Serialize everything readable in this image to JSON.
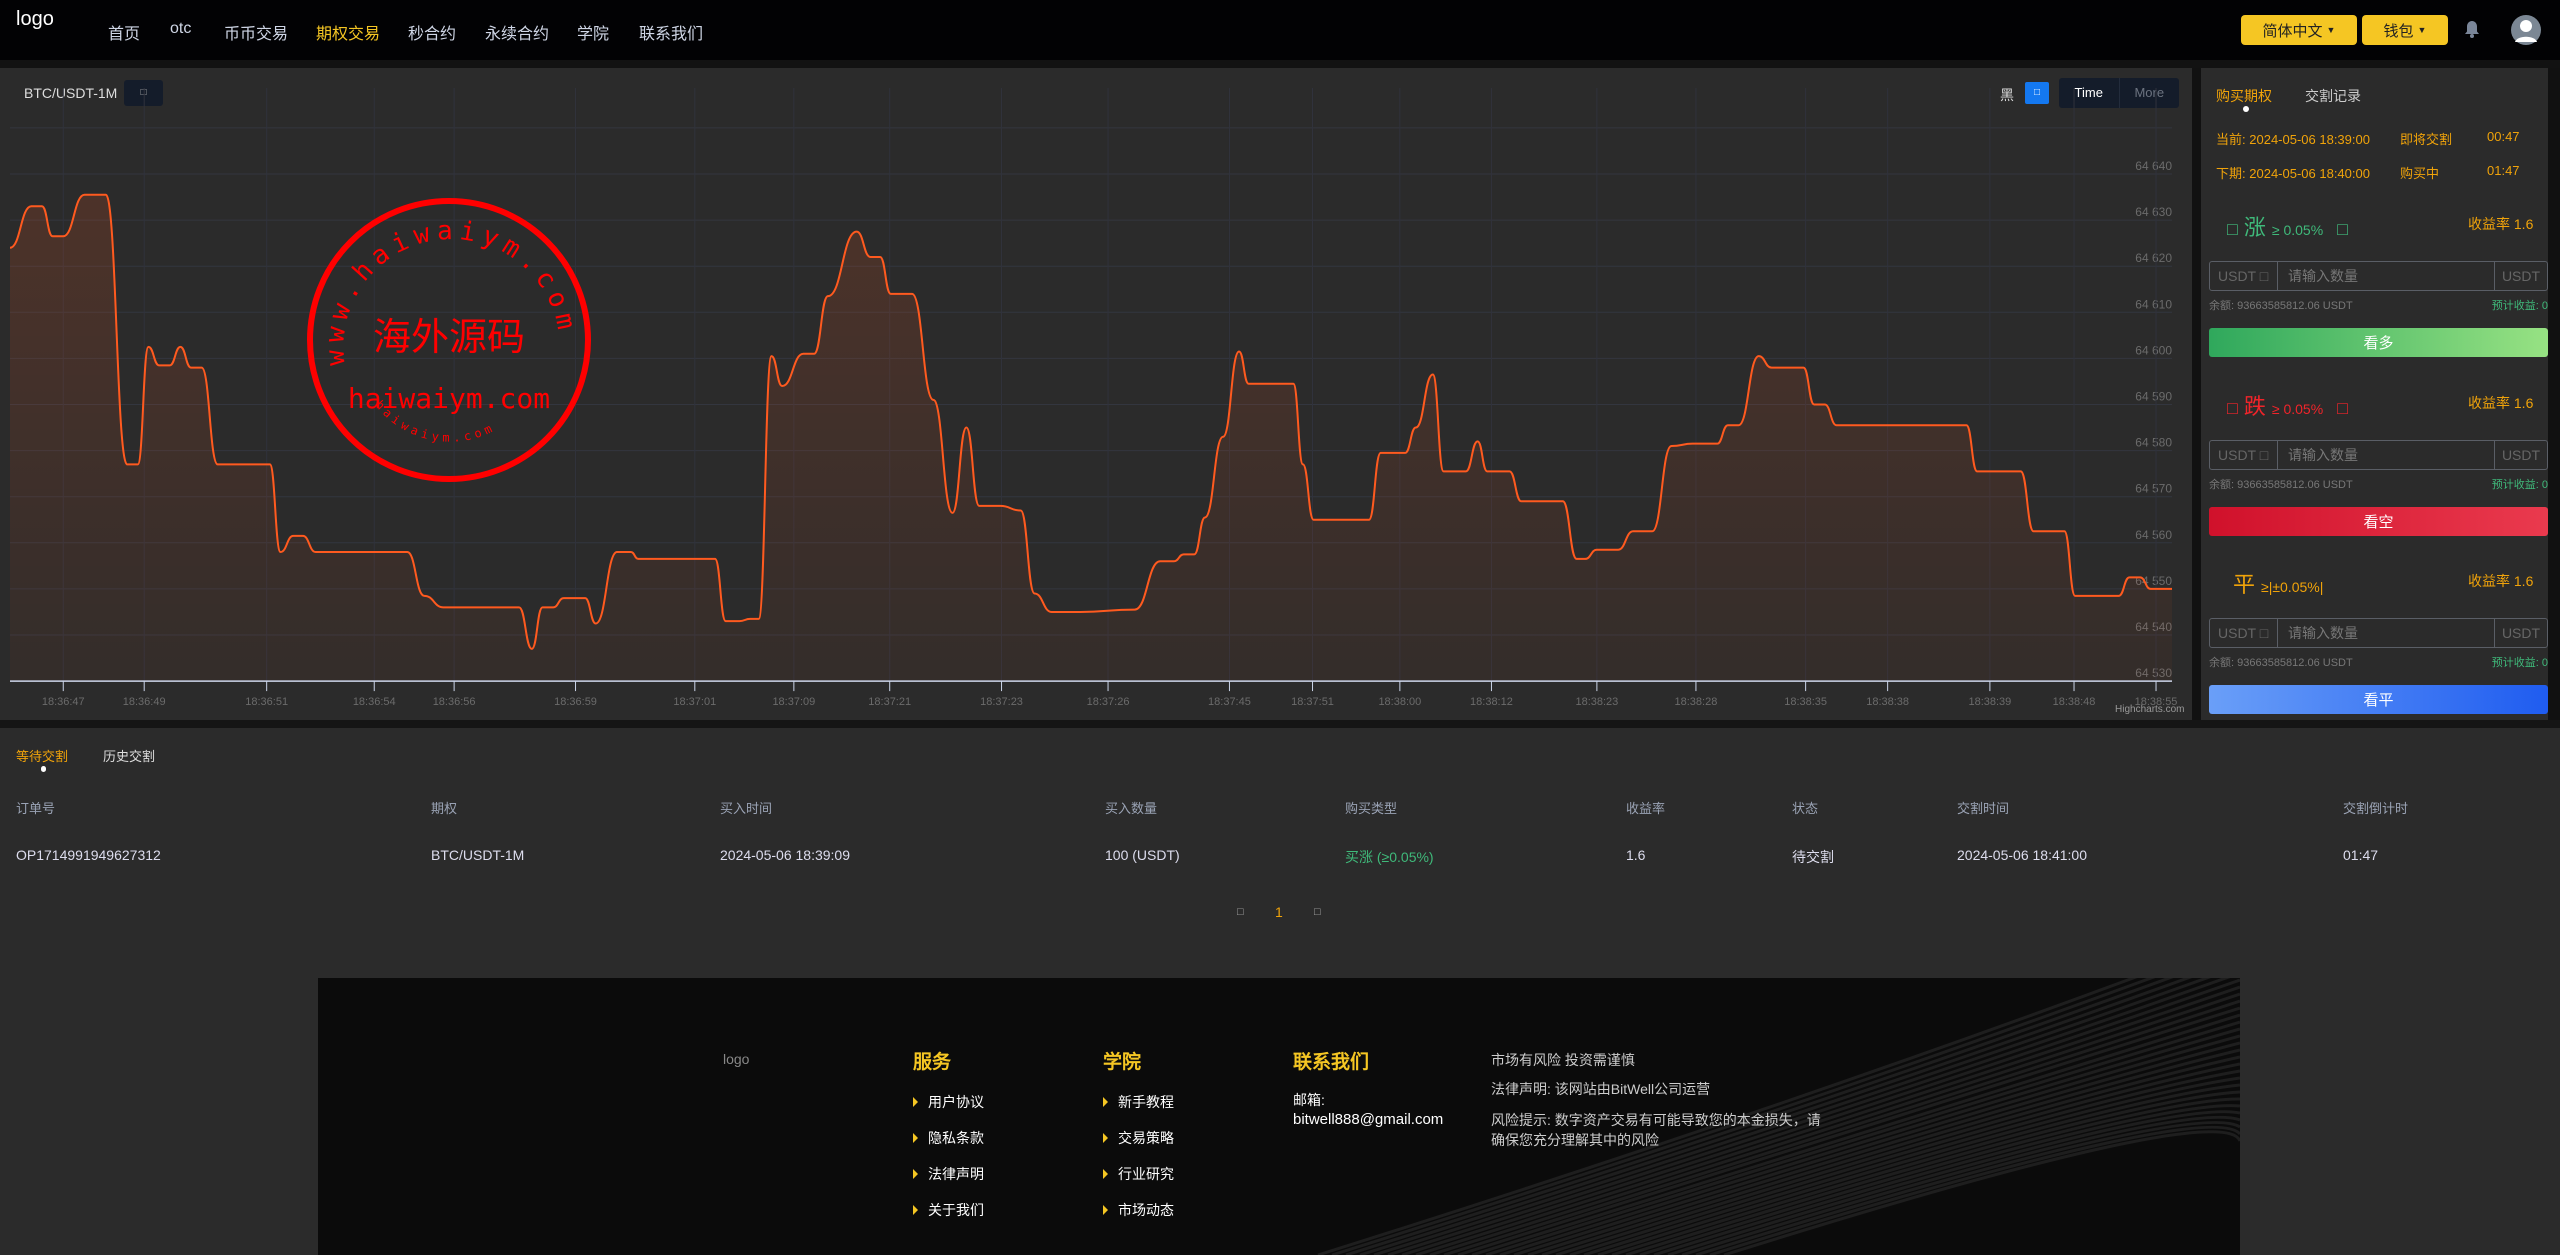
{
  "header": {
    "logo_alt": "logo",
    "nav": [
      "首页",
      "otc",
      "币币交易",
      "期权交易",
      "秒合约",
      "永续合约",
      "学院",
      "联系我们"
    ],
    "active_nav": 3,
    "language": "简体中文",
    "wallet": "钱包",
    "accent": "#f5c623"
  },
  "chart": {
    "pair": "BTC/USDT-1M",
    "theme_label": "黑",
    "range_time": "Time",
    "range_more": "More",
    "credit": "Highcharts.com",
    "watermark": {
      "top_text": "www.haiwaiym.com",
      "center_text": "海外源码",
      "bottom_text": "haiwaiym.com",
      "small_text": "haiwaiym.com"
    }
  },
  "chart_data": {
    "type": "area",
    "line_color": "#ff5a1f",
    "ylim": [
      64530,
      64640
    ],
    "y_ticks": [
      "64 640",
      "64 630",
      "64 620",
      "64 610",
      "64 600",
      "64 590",
      "64 580",
      "64 570",
      "64 560",
      "64 550",
      "64 540",
      "64 530"
    ],
    "y_tick_values": [
      64640,
      64630,
      64620,
      64610,
      64600,
      64590,
      64580,
      64570,
      64560,
      64550,
      64540,
      64530
    ],
    "x_range": [
      0,
      203
    ],
    "x_ticks": [
      {
        "i": 5,
        "label": "18:36:47"
      },
      {
        "i": 12.6,
        "label": "18:36:49"
      },
      {
        "i": 24.1,
        "label": "18:36:51"
      },
      {
        "i": 34.2,
        "label": "18:36:54"
      },
      {
        "i": 41.7,
        "label": "18:36:56"
      },
      {
        "i": 53.1,
        "label": "18:36:59"
      },
      {
        "i": 64.3,
        "label": "18:37:01"
      },
      {
        "i": 73.6,
        "label": "18:37:09"
      },
      {
        "i": 82.6,
        "label": "18:37:21"
      },
      {
        "i": 93.1,
        "label": "18:37:23"
      },
      {
        "i": 103.1,
        "label": "18:37:26"
      },
      {
        "i": 114.5,
        "label": "18:37:45"
      },
      {
        "i": 122.3,
        "label": "18:37:51"
      },
      {
        "i": 130.5,
        "label": "18:38:00"
      },
      {
        "i": 139.1,
        "label": "18:38:12"
      },
      {
        "i": 149,
        "label": "18:38:23"
      },
      {
        "i": 158.3,
        "label": "18:38:28"
      },
      {
        "i": 168.6,
        "label": "18:38:35"
      },
      {
        "i": 176.3,
        "label": "18:38:38"
      },
      {
        "i": 185.9,
        "label": "18:38:39"
      },
      {
        "i": 193.8,
        "label": "18:38:48"
      },
      {
        "i": 201.5,
        "label": "18:38:55"
      }
    ],
    "points": [
      [
        0,
        64624
      ],
      [
        2,
        64633
      ],
      [
        3,
        64633
      ],
      [
        4,
        64626.5
      ],
      [
        5,
        64626.5
      ],
      [
        7,
        64635.5
      ],
      [
        9,
        64635.5
      ],
      [
        11,
        64577
      ],
      [
        12,
        64577
      ],
      [
        13,
        64602.5
      ],
      [
        14,
        64598.5
      ],
      [
        15,
        64598.5
      ],
      [
        16,
        64602.5
      ],
      [
        17,
        64598
      ],
      [
        18,
        64598
      ],
      [
        19.5,
        64577
      ],
      [
        24.4,
        64577
      ],
      [
        25.4,
        64558
      ],
      [
        26.6,
        64561.5
      ],
      [
        27.5,
        64561.5
      ],
      [
        28.7,
        64558
      ],
      [
        37.3,
        64558
      ],
      [
        38.9,
        64548.5
      ],
      [
        40.7,
        64546
      ],
      [
        47.8,
        64546
      ],
      [
        49,
        64537
      ],
      [
        50,
        64546
      ],
      [
        51,
        64546
      ],
      [
        52,
        64548
      ],
      [
        54,
        64548
      ],
      [
        55,
        64542.5
      ],
      [
        57,
        64558
      ],
      [
        58.3,
        64558
      ],
      [
        59,
        64556.5
      ],
      [
        66.2,
        64556.5
      ],
      [
        67.2,
        64543
      ],
      [
        68.5,
        64543
      ],
      [
        69.5,
        64543.5
      ],
      [
        70.3,
        64543.5
      ],
      [
        71.5,
        64600.5
      ],
      [
        72.5,
        64594
      ],
      [
        74.5,
        64601
      ],
      [
        75.5,
        64601
      ],
      [
        76.8,
        64613.5
      ],
      [
        79.5,
        64627.5
      ],
      [
        80.8,
        64622
      ],
      [
        81.7,
        64622
      ],
      [
        82.7,
        64614
      ],
      [
        84.7,
        64614
      ],
      [
        86.7,
        64591
      ],
      [
        88.5,
        64566.5
      ],
      [
        89.8,
        64585
      ],
      [
        91,
        64568
      ],
      [
        93,
        64568
      ],
      [
        94.9,
        64567
      ],
      [
        96.2,
        64549
      ],
      [
        97.8,
        64545
      ],
      [
        100.5,
        64545
      ],
      [
        105.6,
        64545.5
      ],
      [
        108,
        64556
      ],
      [
        109.3,
        64556
      ],
      [
        110.2,
        64557.5
      ],
      [
        111.2,
        64557.5
      ],
      [
        112.2,
        64565.5
      ],
      [
        113.9,
        64583
      ],
      [
        115.4,
        64601.5
      ],
      [
        116.3,
        64594.5
      ],
      [
        120.5,
        64594.5
      ],
      [
        121.4,
        64577
      ],
      [
        122.4,
        64565
      ],
      [
        127.6,
        64565
      ],
      [
        128.7,
        64579.5
      ],
      [
        131,
        64579.5
      ],
      [
        132,
        64585
      ],
      [
        133.6,
        64596.5
      ],
      [
        134.6,
        64575.5
      ],
      [
        136.7,
        64575.5
      ],
      [
        137.8,
        64582
      ],
      [
        138.7,
        64575.5
      ],
      [
        140.8,
        64575.5
      ],
      [
        141.9,
        64569
      ],
      [
        145.8,
        64569
      ],
      [
        147.1,
        64556.5
      ],
      [
        147.9,
        64556.5
      ],
      [
        149,
        64558.5
      ],
      [
        151,
        64558.5
      ],
      [
        152.4,
        64562.5
      ],
      [
        154.2,
        64562.5
      ],
      [
        156,
        64581
      ],
      [
        158,
        64581.5
      ],
      [
        160.3,
        64581.5
      ],
      [
        161.3,
        64585.5
      ],
      [
        162.3,
        64585.5
      ],
      [
        164.2,
        64600.5
      ],
      [
        165.4,
        64598
      ],
      [
        168.4,
        64598
      ],
      [
        169.4,
        64590
      ],
      [
        170.4,
        64590
      ],
      [
        171.5,
        64585.5
      ],
      [
        183.7,
        64585.5
      ],
      [
        184.7,
        64575.5
      ],
      [
        188.8,
        64575.5
      ],
      [
        190,
        64562.5
      ],
      [
        192.9,
        64562.5
      ],
      [
        193.9,
        64548.5
      ],
      [
        198,
        64548.5
      ],
      [
        199,
        64552.5
      ],
      [
        200,
        64552.5
      ],
      [
        201,
        64550
      ],
      [
        203,
        64550
      ]
    ]
  },
  "trade": {
    "tabs": [
      "购买期权",
      "交割记录"
    ],
    "current_label": "当前:",
    "current_time": "2024-05-06 18:39:00",
    "current_status": "即将交割",
    "current_countdown": "00:47",
    "next_label": "下期:",
    "next_time": "2024-05-06 18:40:00",
    "next_status": "购买中",
    "next_countdown": "01:47",
    "options": [
      {
        "icon": "□",
        "title": "涨",
        "cond": "≥ 0.05%",
        "icon2": "□",
        "rate": "收益率 1.6",
        "color": "#3fb97a",
        "currency": "USDT □",
        "placeholder": "请输入数量",
        "unit": "USDT",
        "balance": "余额: 93663585812.06 USDT",
        "estimate": "预计收益: 0",
        "button": "看多"
      },
      {
        "icon": "□",
        "title": "跌",
        "cond": "≥ 0.05%",
        "icon2": "□",
        "rate": "收益率 1.6",
        "color": "#f0242a",
        "currency": "USDT □",
        "placeholder": "请输入数量",
        "unit": "USDT",
        "balance": "余额: 93663585812.06 USDT",
        "estimate": "预计收益: 0",
        "button": "看空"
      },
      {
        "icon": "",
        "title": "平",
        "cond": "≥|±0.05%|",
        "icon2": "",
        "rate": "收益率 1.6",
        "color": "#f0a30a",
        "currency": "USDT □",
        "placeholder": "请输入数量",
        "unit": "USDT",
        "balance": "余额: 93663585812.06 USDT",
        "estimate": "预计收益: 0",
        "button": "看平"
      }
    ]
  },
  "orders": {
    "tabs": [
      "等待交割",
      "历史交割"
    ],
    "columns": [
      "订单号",
      "期权",
      "买入时间",
      "买入数量",
      "购买类型",
      "收益率",
      "状态",
      "交割时间",
      "交割倒计时"
    ],
    "rows": [
      [
        "OP1714991949627312",
        "BTC/USDT-1M",
        "2024-05-06 18:39:09",
        "100 (USDT)",
        "买涨 (≥0.05%)",
        "1.6",
        "待交割",
        "2024-05-06 18:41:00",
        "01:47"
      ]
    ],
    "pagination": {
      "prev": "□",
      "current": "1",
      "next": "□"
    }
  },
  "footer": {
    "logo_alt": "logo",
    "service_title": "服务",
    "service_links": [
      "用户协议",
      "隐私条款",
      "法律声明",
      "关于我们"
    ],
    "academy_title": "学院",
    "academy_links": [
      "新手教程",
      "交易策略",
      "行业研究",
      "市场动态"
    ],
    "contact_title": "联系我们",
    "email_label": "邮箱:",
    "email": "bitwell888@gmail.com",
    "notes": [
      "市场有风险 投资需谨慎",
      "法律声明: 该网站由BitWell公司运营",
      "风险提示: 数字资产交易有可能导致您的本金损失，请",
      "确保您充分理解其中的风险"
    ]
  }
}
